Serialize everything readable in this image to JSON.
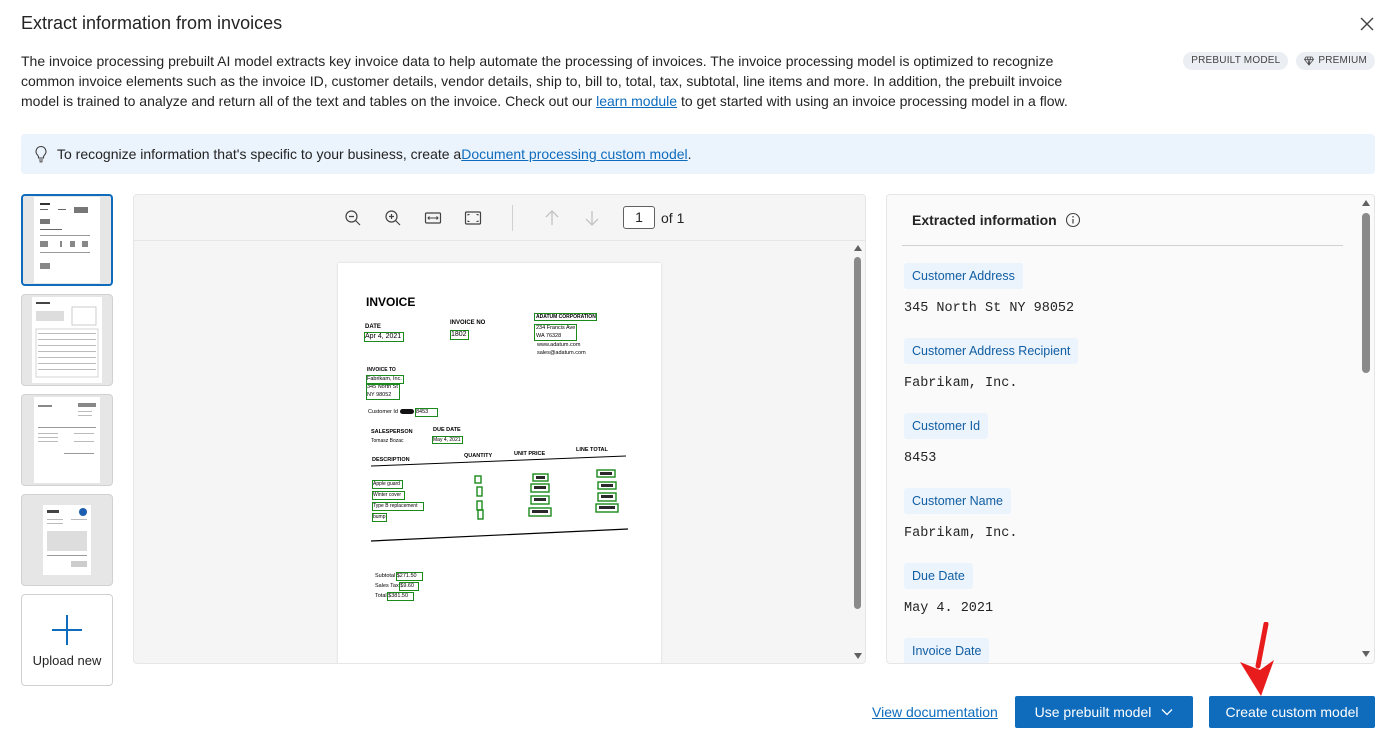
{
  "dialog": {
    "title": "Extract information from invoices",
    "description_1": "The invoice processing prebuilt AI model extracts key invoice data to help automate the processing of invoices. The invoice processing model is optimized to recognize common invoice elements such as the invoice ID, customer details, vendor details, ship to, bill to, total, tax, subtotal, line items and more. In addition, the prebuilt invoice model is trained to analyze and return all of the text and tables on the invoice. Check out our ",
    "description_link": "learn module",
    "description_2": " to get started with using an invoice processing model in a flow."
  },
  "badges": {
    "prebuilt": "PREBUILT MODEL",
    "premium": "PREMIUM"
  },
  "info_bar": {
    "text": "To recognize information that's specific to your business, create a ",
    "link": "Document processing custom model",
    "suffix": "."
  },
  "thumbnails": {
    "upload_label": "Upload new"
  },
  "viewer": {
    "page_current": "1",
    "page_of": "of 1"
  },
  "invoice_sample": {
    "title": "INVOICE",
    "date_label": "DATE",
    "date_value": "Apr 4, 2021",
    "invoice_no_label": "INVOICE NO",
    "invoice_no_value": "1802",
    "vendor_name": "ADATUM CORPORATION",
    "vendor_address_1": "234 Francis Ave",
    "vendor_address_2": "WA 76328",
    "vendor_web": "www.adatum.com",
    "vendor_email": "sales@adatum.com",
    "invoice_to_label": "INVOICE TO",
    "customer_name": "Fabrikam, Inc.",
    "customer_address_1": "345 North St",
    "customer_address_2": "NY 98052",
    "customer_id_label": "Customer Id",
    "customer_id_value": "8453",
    "salesperson_label": "SALESPERSON",
    "salesperson_value": "Tomasz Bozac",
    "due_date_label": "DUE DATE",
    "due_date_value": "May 4, 2021",
    "col_description": "DESCRIPTION",
    "col_quantity": "QUANTITY",
    "col_unit_price": "UNIT PRICE",
    "col_line_total": "LINE TOTAL",
    "items": [
      "Apple guard",
      "Winter cover",
      "Type B replacement",
      "bump"
    ],
    "subtotal_label": "Subtotal",
    "subtotal_value": "$271.50",
    "tax_label": "Sales Tax",
    "tax_value": "$9.60",
    "total_label": "Total",
    "total_value": "$381.50"
  },
  "extracted": {
    "header": "Extracted information",
    "fields": [
      {
        "label": "Customer Address",
        "value": "345 North St NY 98052"
      },
      {
        "label": "Customer Address Recipient",
        "value": "Fabrikam, Inc."
      },
      {
        "label": "Customer Id",
        "value": "8453"
      },
      {
        "label": "Customer Name",
        "value": "Fabrikam, Inc."
      },
      {
        "label": "Due Date",
        "value": "May 4. 2021"
      },
      {
        "label": "Invoice Date",
        "value": ""
      }
    ]
  },
  "footer": {
    "view_docs": "View documentation",
    "use_prebuilt": "Use prebuilt model",
    "create_custom": "Create custom model"
  },
  "colors": {
    "accent": "#0f6cbd",
    "info_bg": "#ebf3fc",
    "field_bg": "#ebf3fc",
    "box_green": "#1a8a1a",
    "arrow_red": "#e81c1c"
  }
}
